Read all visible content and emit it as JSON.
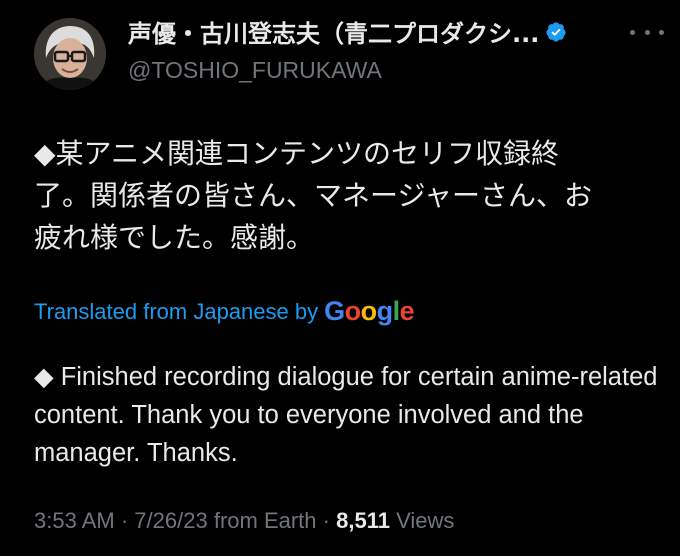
{
  "author": {
    "display_name": "声優・古川登志夫（青二プロダクシ...",
    "handle": "@TOSHIO_FURUKAWA",
    "verified_icon": "verified-badge-icon"
  },
  "more_icon": "more-horizontal-icon",
  "tweet": {
    "original_text": "◆某アニメ関連コンテンツのセリフ収録終\n了。関係者の皆さん、マネージャーさん、お\n疲れ様でした。感謝。",
    "translation_prefix": "Translated from Japanese by",
    "translation_provider": "Google",
    "translated_text": "◆ Finished recording dialogue for certain anime-related content. Thank you to everyone involved and the manager. Thanks."
  },
  "meta": {
    "time": "3:53 AM",
    "date": "7/26/23",
    "source": "from Earth",
    "views_count": "8,511",
    "views_label": "Views",
    "separator": "·"
  },
  "colors": {
    "background": "#000000",
    "text_primary": "#e7e9ea",
    "text_secondary": "#71767b",
    "link": "#1d9bf0",
    "verified": "#1d9bf0"
  }
}
